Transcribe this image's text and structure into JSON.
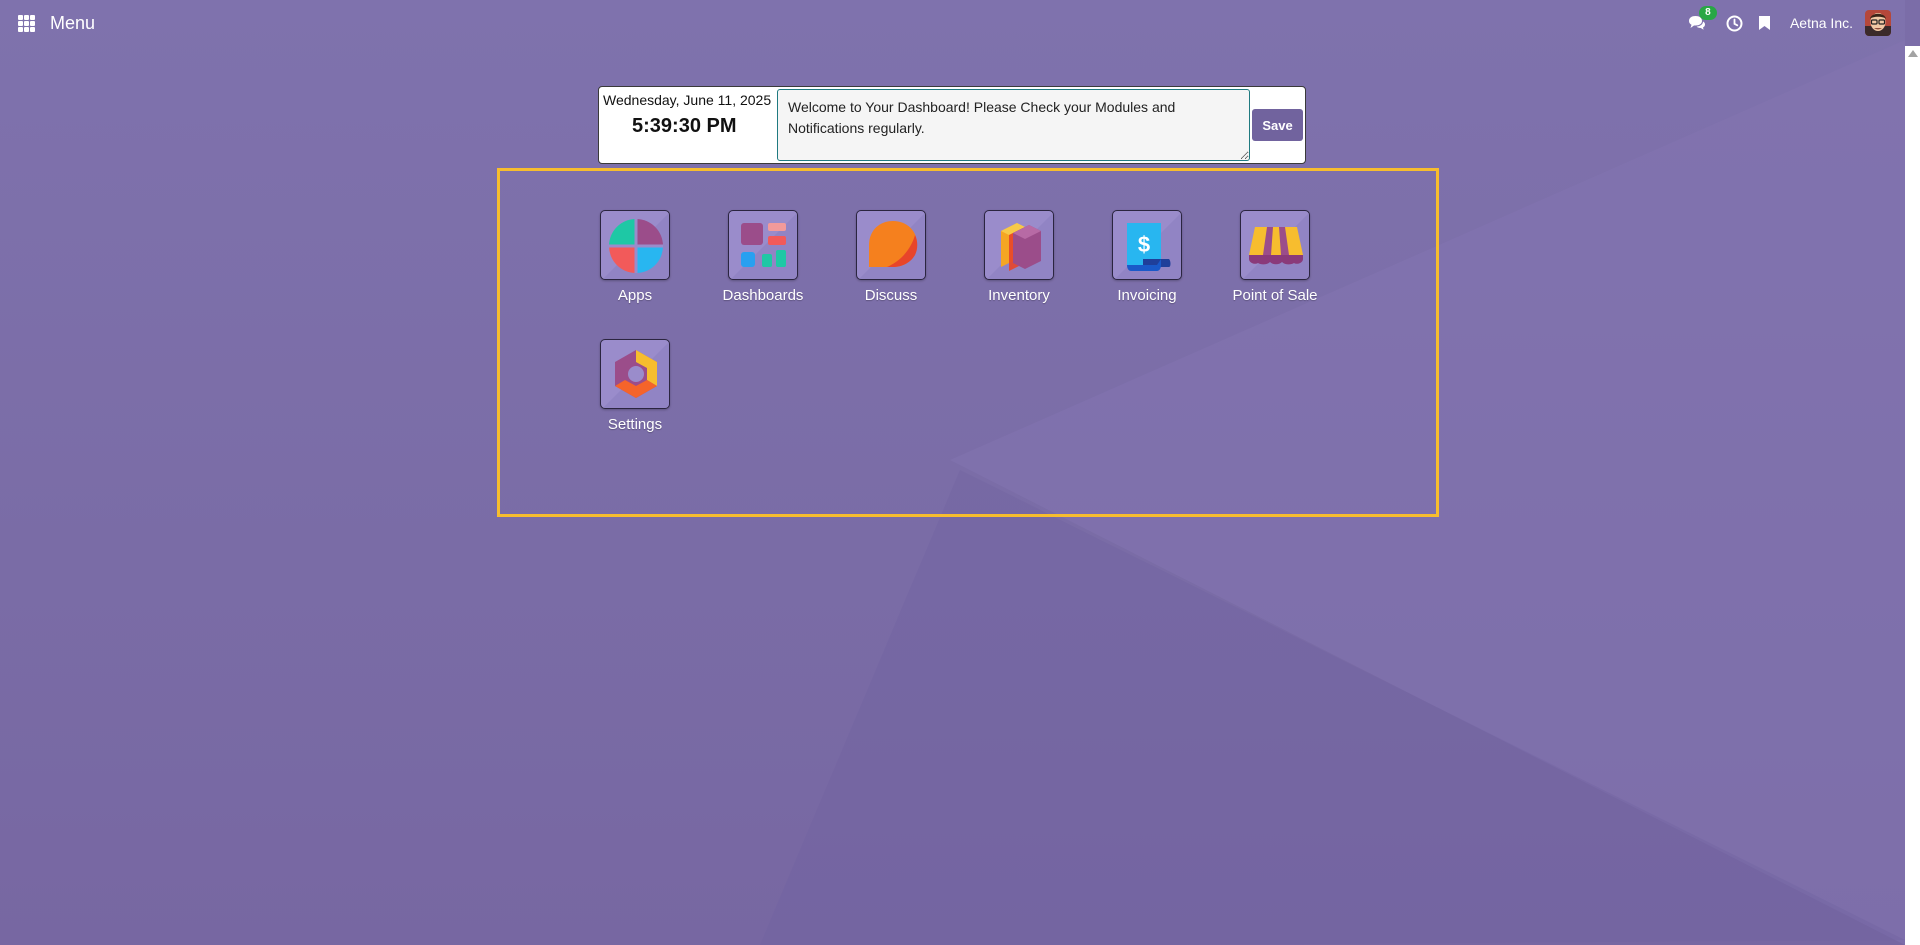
{
  "navbar": {
    "menu_label": "Menu",
    "chat_badge": "8",
    "company": "Aetna Inc.",
    "icons": [
      "grid-icon",
      "chat-icon",
      "clock-icon",
      "bookmark-icon",
      "user-avatar"
    ]
  },
  "header": {
    "date": "Wednesday, June 11, 2025",
    "time": "5:39:30 PM",
    "note": "Welcome to Your Dashboard! Please Check your Modules and Notifications regularly.",
    "save_label": "Save"
  },
  "apps": [
    {
      "label": "Apps",
      "icon": "apps-icon"
    },
    {
      "label": "Dashboards",
      "icon": "dashboards-icon"
    },
    {
      "label": "Discuss",
      "icon": "discuss-icon"
    },
    {
      "label": "Inventory",
      "icon": "inventory-icon"
    },
    {
      "label": "Invoicing",
      "icon": "invoicing-icon"
    },
    {
      "label": "Point of Sale",
      "icon": "point-of-sale-icon"
    },
    {
      "label": "Settings",
      "icon": "settings-icon"
    }
  ],
  "colors": {
    "background": "#7b6da8",
    "accent": "#71639e",
    "frame": "#f7bd2e",
    "badge": "#28a745"
  }
}
